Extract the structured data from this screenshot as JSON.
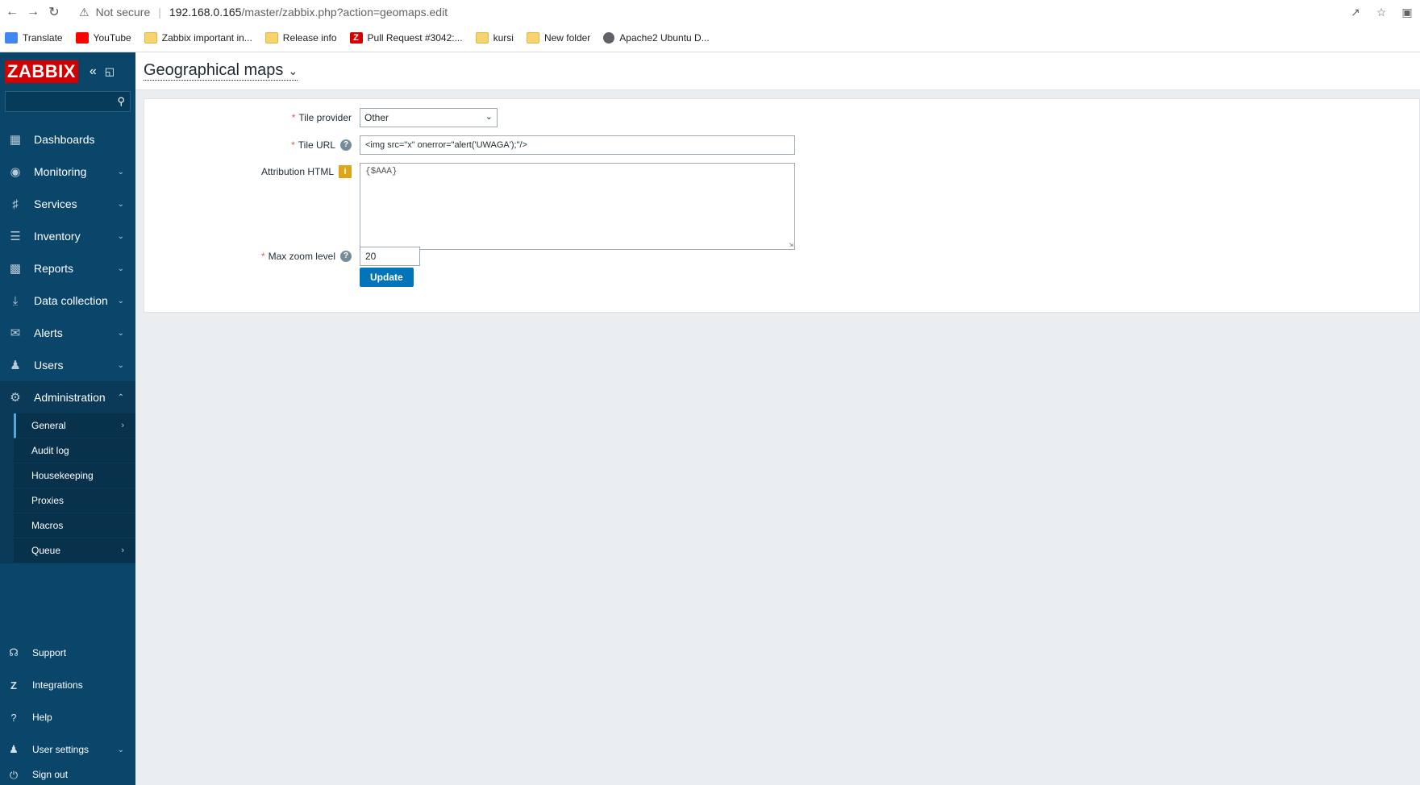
{
  "browser": {
    "security_label": "Not secure",
    "url_host": "192.168.0.165",
    "url_path": "/master/zabbix.php?action=geomaps.edit",
    "bookmarks": [
      {
        "label": "Translate",
        "icon": "translate-icon"
      },
      {
        "label": "YouTube",
        "icon": "youtube-icon"
      },
      {
        "label": "Zabbix important in...",
        "icon": "folder-icon"
      },
      {
        "label": "Release info",
        "icon": "folder-icon"
      },
      {
        "label": "Pull Request #3042:...",
        "icon": "zabbix-z-icon"
      },
      {
        "label": "kursi",
        "icon": "folder-icon"
      },
      {
        "label": "New folder",
        "icon": "folder-icon"
      },
      {
        "label": "Apache2 Ubuntu D...",
        "icon": "globe-icon"
      }
    ]
  },
  "sidebar": {
    "logo": "ZABBIX",
    "search_placeholder": "",
    "menu": [
      {
        "label": "Dashboards",
        "icon": "dashboard-icon"
      },
      {
        "label": "Monitoring",
        "icon": "eye-icon"
      },
      {
        "label": "Services",
        "icon": "services-icon"
      },
      {
        "label": "Inventory",
        "icon": "list-icon"
      },
      {
        "label": "Reports",
        "icon": "report-icon"
      },
      {
        "label": "Data collection",
        "icon": "download-icon"
      },
      {
        "label": "Alerts",
        "icon": "envelope-icon"
      },
      {
        "label": "Users",
        "icon": "users-icon"
      },
      {
        "label": "Administration",
        "icon": "gear-icon"
      }
    ],
    "submenu": [
      {
        "label": "General"
      },
      {
        "label": "Audit log"
      },
      {
        "label": "Housekeeping"
      },
      {
        "label": "Proxies"
      },
      {
        "label": "Macros"
      },
      {
        "label": "Queue"
      }
    ],
    "bottom": [
      {
        "label": "Support",
        "icon": "headset-icon"
      },
      {
        "label": "Integrations",
        "icon": "zabbix-z-icon"
      },
      {
        "label": "Help",
        "icon": "question-icon"
      },
      {
        "label": "User settings",
        "icon": "user-icon"
      },
      {
        "label": "Sign out",
        "icon": "power-icon"
      }
    ]
  },
  "page": {
    "title": "Geographical maps"
  },
  "form": {
    "tile_provider_label": "Tile provider",
    "tile_provider_value": "Other",
    "tile_url_label": "Tile URL",
    "tile_url_value": "<img src=\"x\" onerror=\"alert('UWAGA');\"/>",
    "attribution_label": "Attribution HTML",
    "attribution_value": "{$AAA}",
    "max_zoom_label": "Max zoom level",
    "max_zoom_value": "20",
    "update_button": "Update"
  },
  "colors": {
    "sidebar_bg": "#0a466a",
    "logo_bg": "#d40000",
    "button_bg": "#0275b8",
    "required_star": "#e45959"
  }
}
